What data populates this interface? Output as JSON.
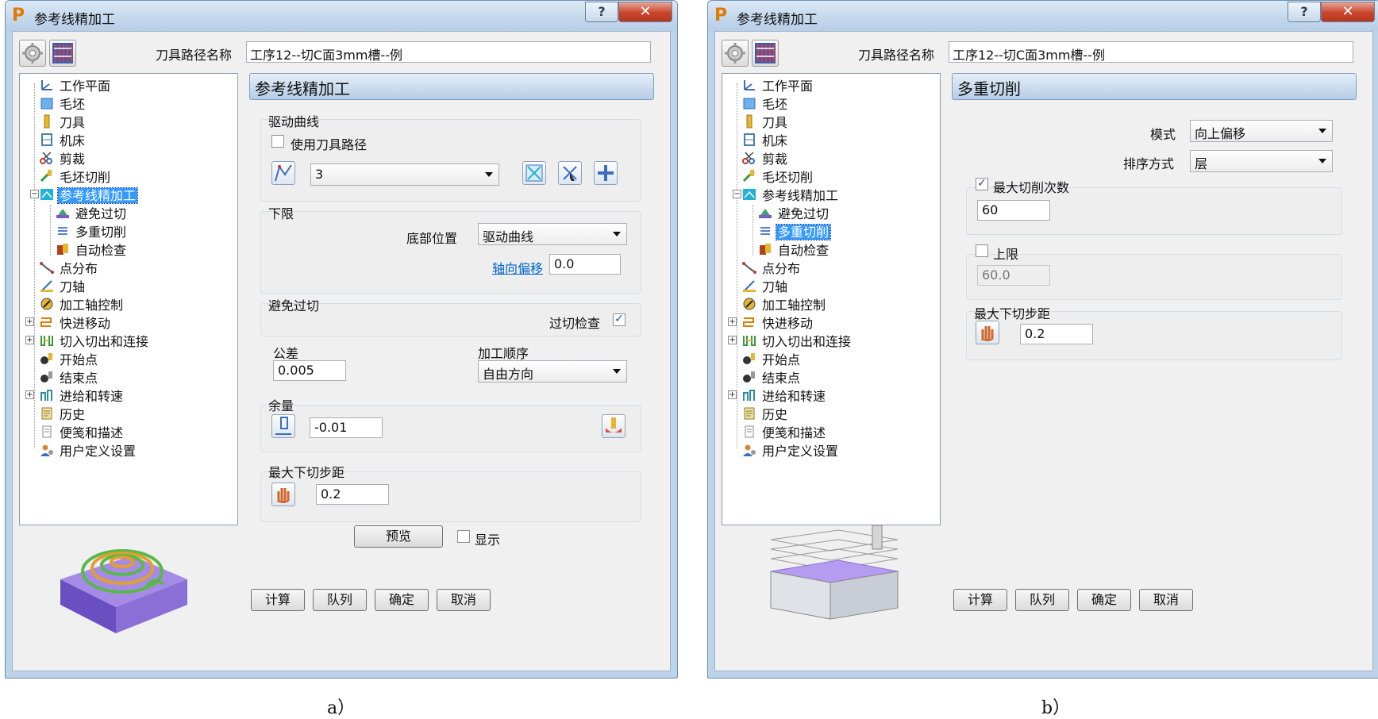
{
  "left": {
    "title": "参考线精加工",
    "help": "?",
    "close": "✕",
    "path_label": "刀具路径名称",
    "path_value": "工序12--切C面3mm槽--例",
    "tree": [
      "工作平面",
      "毛坯",
      "刀具",
      "机床",
      "剪裁",
      "毛坯切削",
      "参考线精加工",
      "避免过切",
      "多重切削",
      "自动检查",
      "点分布",
      "刀轴",
      "加工轴控制",
      "快进移动",
      "切入切出和连接",
      "开始点",
      "结束点",
      "进给和转速",
      "历史",
      "便笺和描述",
      "用户定义设置"
    ],
    "header": "参考线精加工",
    "drive": {
      "label": "驱动曲线",
      "use_path": "使用刀具路径",
      "curve": "3"
    },
    "lower": {
      "label": "下限",
      "bottom_label": "底部位置",
      "bottom_value": "驱动曲线",
      "offset_label": "轴向偏移",
      "offset_value": "0.0"
    },
    "avoid": {
      "label": "避免过切",
      "check_label": "过切检查",
      "checked": "✓"
    },
    "tolerance": {
      "label": "公差",
      "value": "0.005"
    },
    "order": {
      "label": "加工顺序",
      "value": "自由方向"
    },
    "allowance": {
      "label": "余量",
      "value": "-0.01"
    },
    "stepdown": {
      "label": "最大下切步距",
      "value": "0.2"
    },
    "preview": "预览",
    "show": "显示",
    "buttons": [
      "计算",
      "队列",
      "确定",
      "取消"
    ]
  },
  "right": {
    "title": "参考线精加工",
    "help": "?",
    "close": "✕",
    "path_label": "刀具路径名称",
    "path_value": "工序12--切C面3mm槽--例",
    "header": "多重切削",
    "mode_label": "模式",
    "mode_value": "向上偏移",
    "sort_label": "排序方式",
    "sort_value": "层",
    "max_cuts_label": "最大切削次数",
    "max_cuts_checked": "✓",
    "max_cuts_value": "60",
    "upper_label": "上限",
    "upper_value": "60.0",
    "stepdown_label": "最大下切步距",
    "stepdown_value": "0.2",
    "buttons": [
      "计算",
      "队列",
      "确定",
      "取消"
    ]
  },
  "captions": {
    "a": "a）",
    "b": "b）"
  }
}
